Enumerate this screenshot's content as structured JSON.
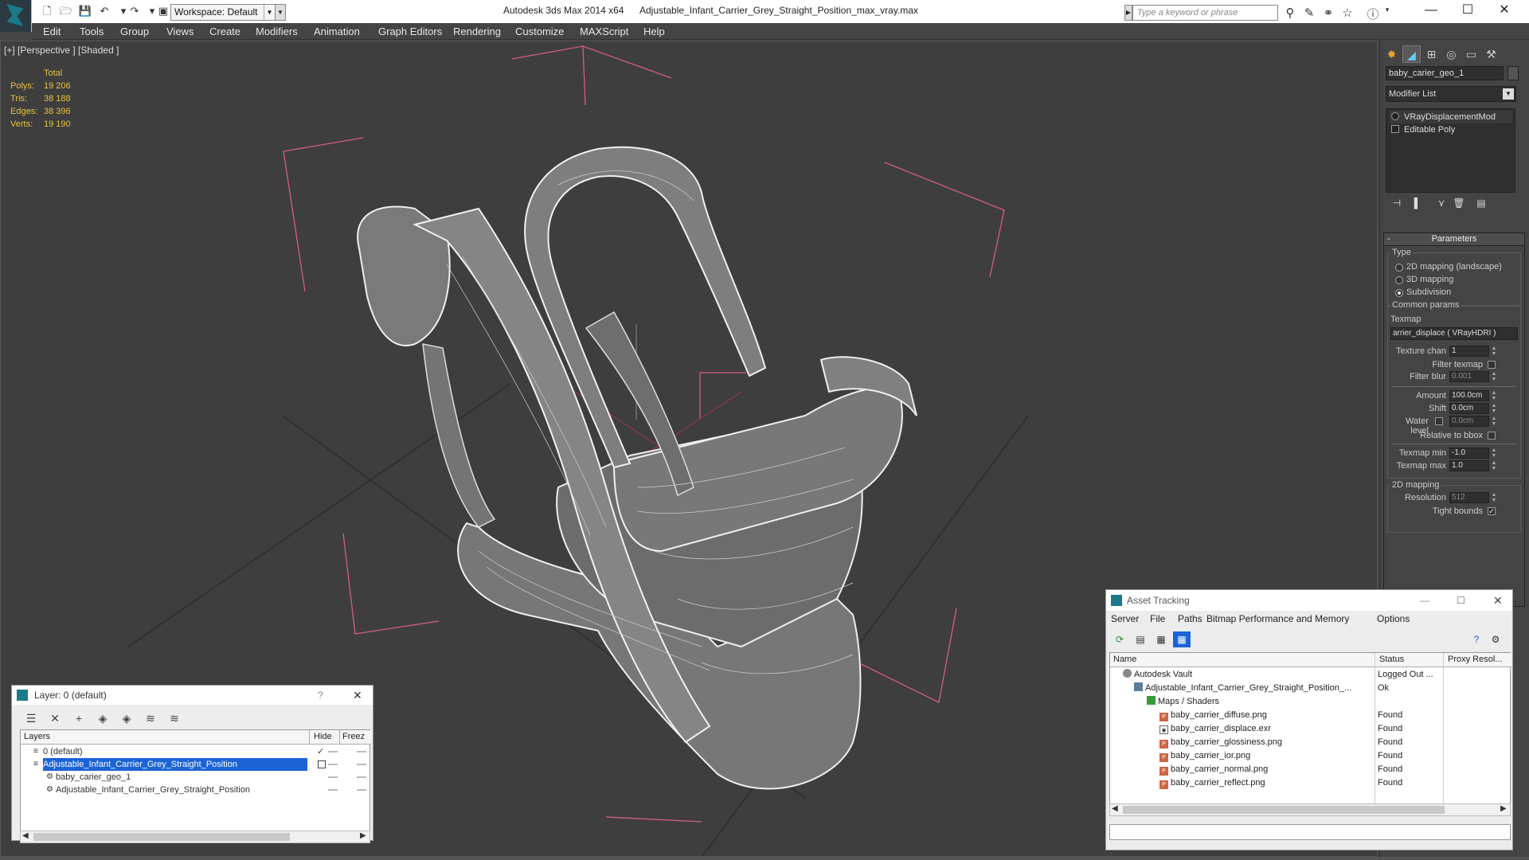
{
  "titlebar": {
    "workspace": "Workspace: Default",
    "app_name": "Autodesk 3ds Max  2014 x64",
    "file_name": "Adjustable_Infant_Carrier_Grey_Straight_Position_max_vray.max",
    "search_placeholder": "Type a keyword or phrase"
  },
  "menu": [
    "Edit",
    "Tools",
    "Group",
    "Views",
    "Create",
    "Modifiers",
    "Animation",
    "Graph Editors",
    "Rendering",
    "Customize",
    "MAXScript",
    "Help"
  ],
  "viewport": {
    "label": "[+] [Perspective ] [Shaded ]",
    "stats": {
      "header": "Total",
      "rows": [
        {
          "label": "Polys:",
          "value": "19 206"
        },
        {
          "label": "Tris:",
          "value": "38 188"
        },
        {
          "label": "Edges:",
          "value": "38 396"
        },
        {
          "label": "Verts:",
          "value": "19 190"
        }
      ]
    }
  },
  "command_panel": {
    "object_name": "baby_carier_geo_1",
    "modifier_list": "Modifier List",
    "stack": [
      "VRayDisplacementMod",
      "Editable Poly"
    ],
    "parameters": {
      "title": "Parameters",
      "type_group": "Type",
      "type_options": [
        "2D mapping (landscape)",
        "3D mapping",
        "Subdivision"
      ],
      "type_selected": 2,
      "common_group": "Common params",
      "texmap_label": "Texmap",
      "texmap_value": "arrier_displace ( VRayHDRI )",
      "texture_chan_label": "Texture chan",
      "texture_chan_value": "1",
      "filter_texmap_label": "Filter texmap",
      "filter_blur_label": "Filter blur",
      "filter_blur_value": "0.001",
      "amount_label": "Amount",
      "amount_value": "100.0cm",
      "shift_label": "Shift",
      "shift_value": "0.0cm",
      "water_level_label": "Water level",
      "water_level_value": "0.0cm",
      "relative_bbox_label": "Relative to bbox",
      "texmap_min_label": "Texmap min",
      "texmap_min_value": "-1.0",
      "texmap_max_label": "Texmap max",
      "texmap_max_value": "1.0",
      "mapping2d_group": "2D mapping",
      "resolution_label": "Resolution",
      "resolution_value": "512",
      "tight_bounds_label": "Tight bounds"
    }
  },
  "layer_window": {
    "title": "Layer: 0 (default)",
    "col_layers": "Layers",
    "col_hide": "Hide",
    "col_freeze": "Freez",
    "rows": [
      {
        "name": "0 (default)"
      },
      {
        "name": "Adjustable_Infant_Carrier_Grey_Straight_Position"
      },
      {
        "name": "baby_carier_geo_1"
      },
      {
        "name": "Adjustable_Infant_Carrier_Grey_Straight_Position"
      }
    ]
  },
  "asset_tracking": {
    "title": "Asset Tracking",
    "menu": [
      "Server",
      "File",
      "Paths",
      "Bitmap Performance and Memory",
      "Options"
    ],
    "col_name": "Name",
    "col_status": "Status",
    "col_proxy": "Proxy Resol...",
    "rows": [
      {
        "name": "Autodesk Vault",
        "status": "Logged Out ...",
        "icon": "vault-icon"
      },
      {
        "name": "Adjustable_Infant_Carrier_Grey_Straight_Position_...",
        "status": "Ok",
        "icon": "max-file-icon"
      },
      {
        "name": "Maps / Shaders",
        "status": "",
        "icon": "maps-folder-icon"
      },
      {
        "name": "baby_carrier_diffuse.png",
        "status": "Found",
        "icon": "png-icon"
      },
      {
        "name": "baby_carrier_displace.exr",
        "status": "Found",
        "icon": "exr-icon"
      },
      {
        "name": "baby_carrier_glossiness.png",
        "status": "Found",
        "icon": "png-icon"
      },
      {
        "name": "baby_carrier_ior.png",
        "status": "Found",
        "icon": "png-icon"
      },
      {
        "name": "baby_carrier_normal.png",
        "status": "Found",
        "icon": "png-icon"
      },
      {
        "name": "baby_carrier_reflect.png",
        "status": "Found",
        "icon": "png-icon"
      }
    ]
  },
  "colors": {
    "stats_text": "#e8c23c",
    "layer_selection": "#1c63d6",
    "bbox_lines": "#d0607a",
    "viewport_bg": "#3e3e3e"
  }
}
